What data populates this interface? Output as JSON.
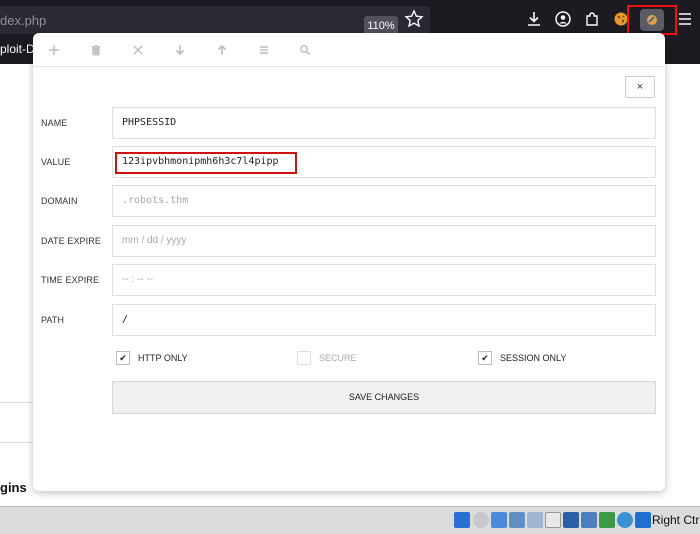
{
  "browser": {
    "url_fragment": "dex.php",
    "zoom": "110%",
    "tab_fragment": "ploit-D"
  },
  "page": {
    "bottom_text": "gins"
  },
  "popup": {
    "toolbar_icons": [
      "add-icon",
      "trash-icon",
      "clear-icon",
      "import-icon",
      "export-icon",
      "list-icon",
      "search-icon"
    ],
    "close_label": "×",
    "fields": {
      "name_label": "NAME",
      "name_value": "PHPSESSID",
      "value_label": "VALUE",
      "value_value": "123ipvbhmonipmh6h3c7l4pipp",
      "domain_label": "DOMAIN",
      "domain_placeholder": ".robots.thm",
      "date_label": "DATE EXPIRE",
      "date_placeholder": "mm / dd / yyyy",
      "time_label": "TIME EXPIRE",
      "time_placeholder": "-- : --   --",
      "path_label": "PATH",
      "path_value": "/"
    },
    "checks": {
      "http_only_label": "HTTP ONLY",
      "http_only_mark": "✔",
      "secure_label": "SECURE",
      "secure_mark": "",
      "session_only_label": "SESSION ONLY",
      "session_only_mark": "✔"
    },
    "save_label": "SAVE CHANGES"
  },
  "taskbar": {
    "right_text": "Right Ctrl"
  },
  "colors": {
    "highlight": "#e11111",
    "toolbar_bg": "#1c1b22"
  }
}
